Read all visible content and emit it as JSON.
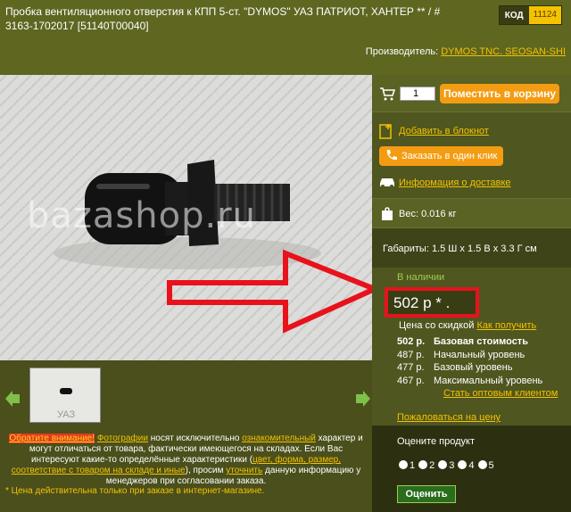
{
  "header": {
    "title": "Пробка вентиляционного отверстия к КПП 5-ст. \"DYMOS\" УАЗ ПАТРИОТ, ХАНТЕР ** / # 3163-1702017 [51140T00040]",
    "code_label": "КОД",
    "code_value": "11124",
    "maker_label": "Производитель:",
    "maker_link": "DYMOS TNC. SEOSAN-SHI"
  },
  "photo": {
    "watermark": "bazashop.ru",
    "thumb_text": "УАЗ"
  },
  "notice": {
    "warn": "Обратите внимание!",
    "photos": "Фотографии",
    "t1": " носят исключительно ",
    "informative": "ознакомительный",
    "t2": " характер и могут отличаться от товара, фактически имеющегося на складах. Если Вас интересуют какие-то определённые характеристики (",
    "specs": "цвет, форма, размер, соответствие с товаром на складе и иные",
    "t3": "), просим ",
    "clarify": "уточнить",
    "t4": " данную информацию у менеджеров при согласовании заказа.",
    "footer": "* Цена действительна только при заказе в интернет-магазине."
  },
  "sidebar": {
    "qty": "1",
    "cart_button": "Поместить в корзину",
    "notebook": "Добавить в блокнот",
    "one_click": "Заказать в один клик",
    "delivery": "Информация о доставке",
    "weight": "Вес: 0.016 кг",
    "dimensions": "Габариты: 1.5 Ш х 1.5 В х 3.3 Г см",
    "stock": "В наличии",
    "price": "502 р * .",
    "discount_label": "Цена со скидкой",
    "discount_link": "Как получить",
    "prices": [
      {
        "value": "502 р.",
        "level": "Базовая стоимость"
      },
      {
        "value": "487 р.",
        "level": "Начальный уровень"
      },
      {
        "value": "477 р.",
        "level": "Базовый уровень"
      },
      {
        "value": "467 р.",
        "level": "Максимальный уровень"
      }
    ],
    "wholesale": "Стать оптовым клиентом",
    "complain": "Пожаловаться на цену",
    "rate_title": "Оцените продукт",
    "ratings": [
      "1",
      "2",
      "3",
      "4",
      "5"
    ],
    "rate_button": "Оценить"
  },
  "colors": {
    "accent": "#f39c12",
    "link": "#f3c200",
    "highlight": "#e8121c",
    "stock": "#9dcc4d"
  }
}
